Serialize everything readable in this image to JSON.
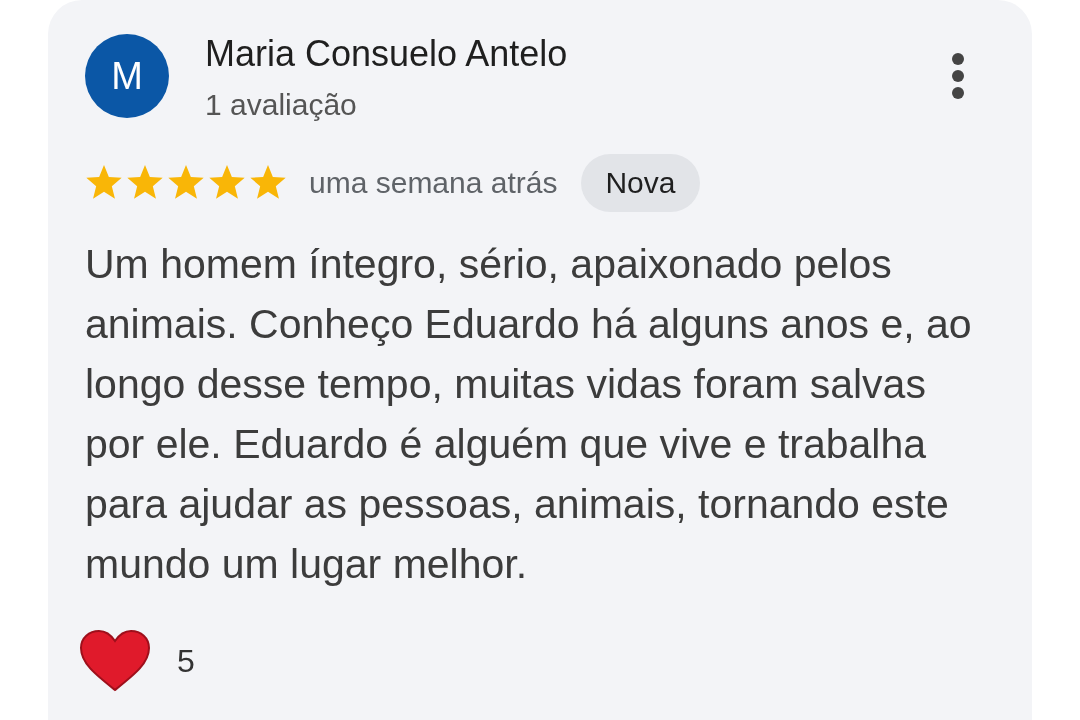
{
  "review": {
    "author": {
      "initial": "M",
      "name": "Maria Consuelo Antelo",
      "reviews": "1 avaliação"
    },
    "stars": 5,
    "time": "uma semana atrás",
    "badge": "Nova",
    "text": "Um homem íntegro, sério, apaixonado pelos animais. Conheço Eduardo há alguns anos e, ao longo desse tempo, muitas vidas foram salvas por ele. Eduardo é alguém que vive e trabalha para ajudar as pessoas, animais, tornando este mundo um lugar melhor.",
    "reactions": {
      "count": "5"
    }
  }
}
